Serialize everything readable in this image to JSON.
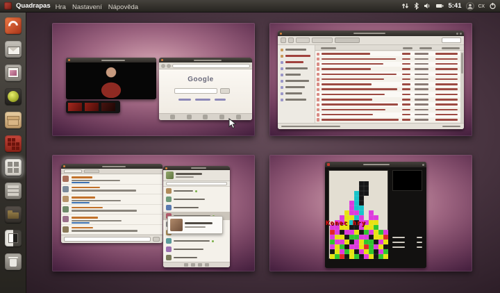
{
  "panel": {
    "app_name": "Quadrapas",
    "menus": [
      "Hra",
      "Nastavení",
      "Nápověda"
    ],
    "indicators": [
      "network",
      "bluetooth",
      "volume",
      "battery"
    ],
    "clock": "5:41",
    "username": "cx"
  },
  "launcher": {
    "items": [
      "dash-home",
      "mail",
      "photos",
      "media-player",
      "software-center",
      "quadrapassel",
      "workspace-switcher",
      "file-cabinet",
      "folder",
      "screens",
      "trash"
    ],
    "active_item": "workspace-switcher"
  },
  "colors": {
    "wallpaper_purple": "#9e6581",
    "panel_bg": "#2e2b27",
    "titlebar_close_orange": "#d8813a",
    "file_text_red": "#9c4a42",
    "game_over_red": "#e11414"
  },
  "workspaces": {
    "ws1": {
      "name": "workspace-1",
      "windows": [
        "video-player",
        "filmstrip",
        "browser"
      ],
      "browser": {
        "logo": "Google"
      },
      "filmstrip_thumbnails": 3
    },
    "ws2": {
      "name": "workspace-2",
      "windows": [
        "file-manager"
      ],
      "file_manager": {
        "sidebar_rows": 9,
        "file_rows": 14,
        "path_segments": 3,
        "columns": 4
      }
    },
    "ws3": {
      "name": "workspace-3",
      "windows": [
        "message-stream",
        "contact-list"
      ],
      "messages": 6,
      "contacts": 9,
      "selected_contact_index": 3
    },
    "ws4": {
      "name": "workspace-4",
      "windows": [
        "quadrapassel-game"
      ],
      "game": {
        "overlay_text": "Konec hry",
        "score_lines": 3,
        "board_colors": {
          "K": "#161616",
          "M": "#dd3add",
          "Y": "#e6e312",
          "C": "#17c3c9",
          "G": "#2ec52e",
          "R": "#e02727"
        },
        "board": [
          "............",
          "............",
          "......KK....",
          "......KK....",
          ".....CKK....",
          ".....CK.....",
          "....MCK.....",
          "....MCC.....",
          "...YMMC.M...",
          "..MYYCM.MM..",
          ".MMYCKMMYY..",
          "MMYYKKMYYG..",
          "RMKMMYKGMYGM",
          "MYYKGGMMKYYR",
          "GMMYKMYGGKMY",
          "MYGKMMYRGMYK",
          "KYMGYKMYGKMG",
          "YGRKYGKMYKGY"
        ]
      }
    }
  }
}
